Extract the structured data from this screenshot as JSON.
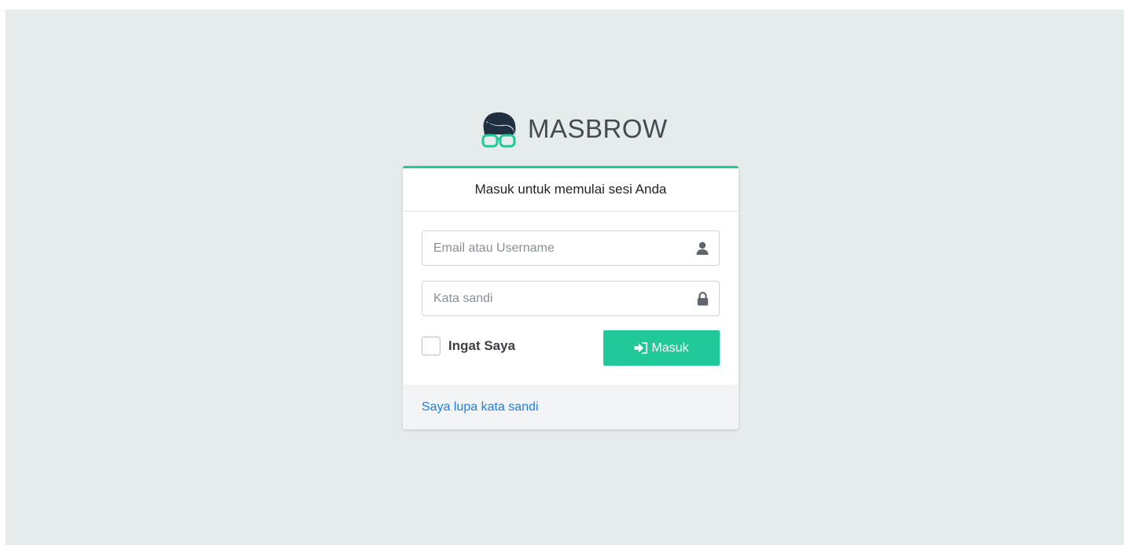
{
  "brand": {
    "name": "MASBROW",
    "logo_icon": "nerd-glasses-logo-icon"
  },
  "login_card": {
    "header": "Masuk untuk memulai sesi Anda",
    "accent_color": "#20c997",
    "email_field": {
      "placeholder": "Email atau Username",
      "value": "",
      "icon": "user-icon"
    },
    "password_field": {
      "placeholder": "Kata sandi",
      "value": "",
      "icon": "lock-icon"
    },
    "remember_me": {
      "label": "Ingat Saya",
      "checked": false
    },
    "submit_button": {
      "label": "Masuk",
      "icon": "sign-in-icon",
      "color": "#20c997"
    },
    "footer": {
      "forgot_password_link": "Saya lupa kata sandi",
      "link_color": "#1e7ee6"
    }
  },
  "page": {
    "background_color": "#e6ebeb"
  }
}
